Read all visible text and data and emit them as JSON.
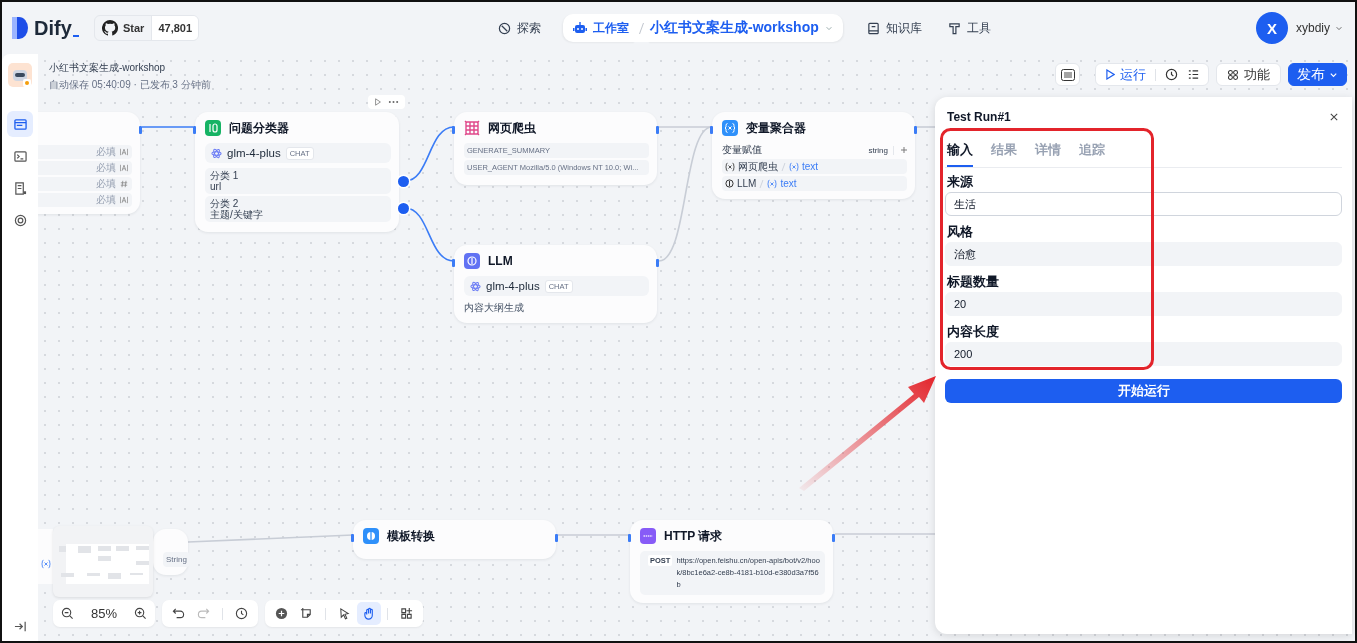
{
  "header": {
    "logo": "Dify",
    "github": {
      "label": "Star",
      "count": "47,801"
    }
  },
  "nav": [
    {
      "kind": "explore",
      "label": "探索",
      "selected": false
    },
    {
      "kind": "studio",
      "label": "工作室",
      "app": "小红书文案生成-workshop",
      "selected": true
    },
    {
      "kind": "knowledge",
      "label": "知识库",
      "selected": false
    },
    {
      "kind": "tools",
      "label": "工具",
      "selected": false
    }
  ],
  "user": {
    "initial": "X",
    "name": "xybdiy"
  },
  "sidebar": {
    "items": [
      {
        "kind": "workflow",
        "selected": true
      },
      {
        "kind": "logs",
        "selected": false
      },
      {
        "kind": "docs",
        "selected": false
      },
      {
        "kind": "monitor",
        "selected": false
      }
    ]
  },
  "app": {
    "title": "小红书文案生成-workshop",
    "status": "自动保存 05:40:09 · 已发布 3 分钟前"
  },
  "toolbar": {
    "run": "运行",
    "features": "功能",
    "publish": "发布"
  },
  "nodes": [
    {
      "kind": "start",
      "rows": [
        {
          "required": "必填",
          "kind": "text"
        },
        {
          "required": "必填",
          "kind": "text"
        },
        {
          "required": "必填",
          "kind": "number"
        },
        {
          "required": "必填",
          "kind": "text"
        }
      ]
    },
    {
      "kind": "classifier",
      "title": "问题分类器",
      "model": "glm-4-plus",
      "mode": "CHAT",
      "classes": [
        {
          "label": "分类 1",
          "value": "url"
        },
        {
          "label": "分类 2",
          "value": "主题/关键字"
        }
      ]
    },
    {
      "kind": "crawler",
      "title": "网页爬虫",
      "params": [
        "GENERATE_SUMMARY",
        "USER_AGENT Mozilla/5.0 (Windows NT 10.0; Wi..."
      ]
    },
    {
      "kind": "aggregator",
      "title": "变量聚合器",
      "label": "变量赋值",
      "type": "string",
      "vars": [
        {
          "kind": "crawler",
          "node": "网页爬虫",
          "name": "text"
        },
        {
          "kind": "llm",
          "node": "LLM",
          "name": "text"
        }
      ]
    },
    {
      "kind": "llm",
      "title": "LLM",
      "model": "glm-4-plus",
      "mode": "CHAT",
      "description": "内容大纲生成"
    },
    {
      "kind": "output",
      "type": "String"
    },
    {
      "kind": "template",
      "title": "模板转换"
    },
    {
      "kind": "http",
      "title": "HTTP 请求",
      "method": "POST",
      "url": "https://open.feishu.cn/open-apis/bot/v2/hook/8bc1e6a2-ce8b-4181-b10d-e380d3a7f56b"
    }
  ],
  "zoom": "85%",
  "panel": {
    "title": "Test Run#1",
    "tabs": [
      {
        "label": "输入",
        "selected": true
      },
      {
        "label": "结果",
        "selected": false
      },
      {
        "label": "详情",
        "selected": false
      },
      {
        "label": "追踪",
        "selected": false
      }
    ],
    "fields": [
      {
        "label": "来源",
        "value": "生活",
        "focused": true
      },
      {
        "label": "风格",
        "value": "治愈",
        "focused": false
      },
      {
        "label": "标题数量",
        "value": "20",
        "focused": false
      },
      {
        "label": "内容长度",
        "value": "200",
        "focused": false
      }
    ],
    "button": "开始运行"
  }
}
